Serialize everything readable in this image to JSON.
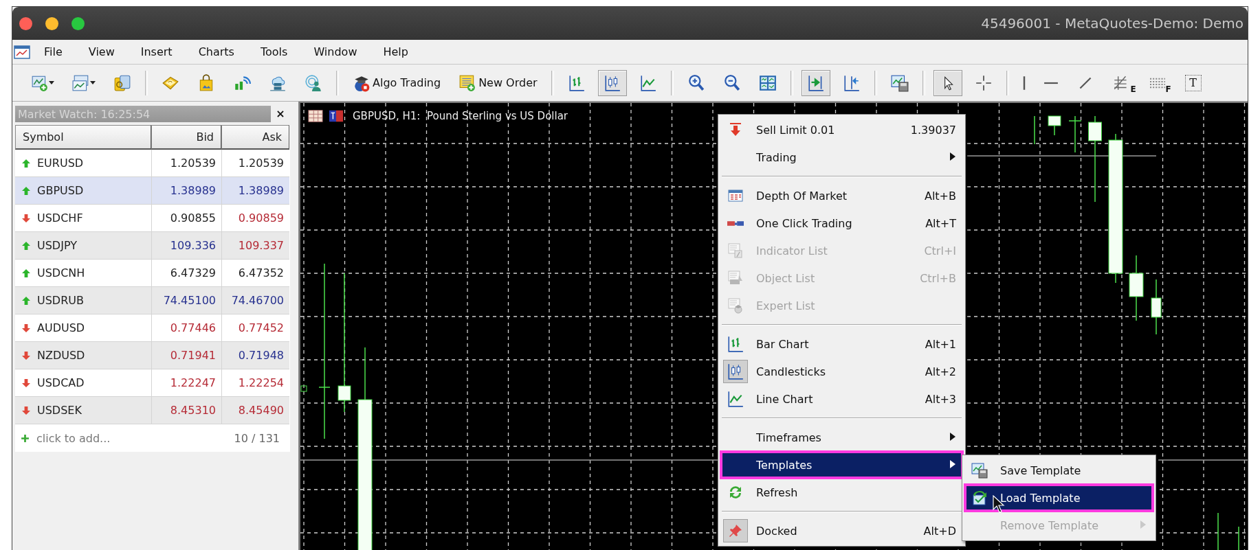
{
  "window": {
    "title": "45496001 - MetaQuotes-Demo: Demo"
  },
  "menu": [
    "File",
    "View",
    "Insert",
    "Charts",
    "Tools",
    "Window",
    "Help"
  ],
  "toolbar": [
    {
      "kind": "icon",
      "pressed": false,
      "dropdown": true
    },
    {
      "kind": "icon",
      "pressed": false,
      "dropdown": true
    },
    {
      "kind": "icon",
      "pressed": false,
      "dropdown": false
    },
    {
      "kind": "separator"
    },
    {
      "kind": "icon",
      "pressed": false,
      "dropdown": false
    },
    {
      "kind": "icon",
      "pressed": false,
      "dropdown": false
    },
    {
      "kind": "icon",
      "pressed": false,
      "dropdown": false
    },
    {
      "kind": "icon",
      "pressed": false,
      "dropdown": false
    },
    {
      "kind": "icon",
      "pressed": false,
      "dropdown": false
    },
    {
      "kind": "separator"
    },
    {
      "kind": "text",
      "label": "Algo Trading",
      "pressed": false
    },
    {
      "kind": "text",
      "label": "New Order",
      "pressed": false
    },
    {
      "kind": "separator"
    },
    {
      "kind": "icon",
      "pressed": false,
      "dropdown": false
    },
    {
      "kind": "icon",
      "pressed": true,
      "dropdown": false
    },
    {
      "kind": "icon",
      "pressed": false,
      "dropdown": false
    },
    {
      "kind": "separator"
    },
    {
      "kind": "icon",
      "pressed": false,
      "dropdown": false
    },
    {
      "kind": "icon",
      "pressed": false,
      "dropdown": false
    },
    {
      "kind": "icon",
      "pressed": false,
      "dropdown": false
    },
    {
      "kind": "separator"
    },
    {
      "kind": "icon",
      "pressed": true,
      "dropdown": false
    },
    {
      "kind": "icon",
      "pressed": false,
      "dropdown": false
    },
    {
      "kind": "separator"
    },
    {
      "kind": "icon",
      "pressed": false,
      "dropdown": false
    },
    {
      "kind": "separator"
    },
    {
      "kind": "icon",
      "pressed": true,
      "dropdown": false
    },
    {
      "kind": "icon",
      "pressed": false,
      "dropdown": false
    },
    {
      "kind": "separator"
    },
    {
      "kind": "icon",
      "pressed": false,
      "dropdown": false
    },
    {
      "kind": "icon",
      "pressed": false,
      "dropdown": false
    },
    {
      "kind": "icon",
      "pressed": false,
      "dropdown": false
    },
    {
      "kind": "badge-icon",
      "badge": "E",
      "pressed": false
    },
    {
      "kind": "badge-icon",
      "badge": "F",
      "pressed": false
    },
    {
      "kind": "letter",
      "label": "T",
      "pressed": false
    }
  ],
  "market_watch": {
    "title": "Market Watch: 16:25:54",
    "close": "×",
    "columns": [
      "Symbol",
      "Bid",
      "Ask"
    ],
    "rows": [
      {
        "symbol": "EURUSD",
        "bid": {
          "value": "1.20539",
          "color": "#222222"
        },
        "ask": {
          "value": "1.20539",
          "color": "#222222"
        },
        "rising": true,
        "selected": false
      },
      {
        "symbol": "GBPUSD",
        "bid": {
          "value": "1.38989",
          "color": "#27318f"
        },
        "ask": {
          "value": "1.38989",
          "color": "#27318f"
        },
        "rising": true,
        "selected": true
      },
      {
        "symbol": "USDCHF",
        "bid": {
          "value": "0.90855",
          "color": "#222222"
        },
        "ask": {
          "value": "0.90859",
          "color": "#b52a35"
        },
        "rising": false,
        "selected": false
      },
      {
        "symbol": "USDJPY",
        "bid": {
          "value": "109.336",
          "color": "#27318f"
        },
        "ask": {
          "value": "109.337",
          "color": "#b52a35"
        },
        "rising": true,
        "selected": false
      },
      {
        "symbol": "USDCNH",
        "bid": {
          "value": "6.47329",
          "color": "#222222"
        },
        "ask": {
          "value": "6.47352",
          "color": "#222222"
        },
        "rising": true,
        "selected": false
      },
      {
        "symbol": "USDRUB",
        "bid": {
          "value": "74.45100",
          "color": "#27318f"
        },
        "ask": {
          "value": "74.46700",
          "color": "#27318f"
        },
        "rising": true,
        "selected": false
      },
      {
        "symbol": "AUDUSD",
        "bid": {
          "value": "0.77446",
          "color": "#b52a35"
        },
        "ask": {
          "value": "0.77452",
          "color": "#b52a35"
        },
        "rising": false,
        "selected": false
      },
      {
        "symbol": "NZDUSD",
        "bid": {
          "value": "0.71941",
          "color": "#b52a35"
        },
        "ask": {
          "value": "0.71948",
          "color": "#27318f"
        },
        "rising": false,
        "selected": false
      },
      {
        "symbol": "USDCAD",
        "bid": {
          "value": "1.22247",
          "color": "#b52a35"
        },
        "ask": {
          "value": "1.22254",
          "color": "#b52a35"
        },
        "rising": false,
        "selected": false
      },
      {
        "symbol": "USDSEK",
        "bid": {
          "value": "8.45310",
          "color": "#b52a35"
        },
        "ask": {
          "value": "8.45490",
          "color": "#b52a35"
        },
        "rising": false,
        "selected": false
      }
    ],
    "add_label": "click to add...",
    "count": "10 / 131"
  },
  "chart": {
    "title": "GBPUSD, H1:  Pound Sterling vs US Dollar"
  },
  "context_menu": {
    "items": [
      {
        "kind": "item",
        "label": "Sell Limit 0.01",
        "shortcut": "1.39037",
        "disabled": false,
        "selected": false,
        "checked": false,
        "submenu": false,
        "outlined": false
      },
      {
        "kind": "item",
        "label": "Trading",
        "disabled": false,
        "selected": false,
        "checked": false,
        "submenu": true,
        "outlined": false
      },
      {
        "kind": "separator"
      },
      {
        "kind": "item",
        "label": "Depth Of Market",
        "shortcut": "Alt+B",
        "disabled": false,
        "selected": false,
        "checked": false,
        "submenu": false,
        "outlined": false
      },
      {
        "kind": "item",
        "label": "One Click Trading",
        "shortcut": "Alt+T",
        "disabled": false,
        "selected": false,
        "checked": false,
        "submenu": false,
        "outlined": false
      },
      {
        "kind": "item",
        "label": "Indicator List",
        "shortcut": "Ctrl+I",
        "disabled": true,
        "selected": false,
        "checked": false,
        "submenu": false,
        "outlined": false
      },
      {
        "kind": "item",
        "label": "Object List",
        "shortcut": "Ctrl+B",
        "disabled": true,
        "selected": false,
        "checked": false,
        "submenu": false,
        "outlined": false
      },
      {
        "kind": "item",
        "label": "Expert List",
        "disabled": true,
        "selected": false,
        "checked": false,
        "submenu": false,
        "outlined": false
      },
      {
        "kind": "separator"
      },
      {
        "kind": "item",
        "label": "Bar Chart",
        "shortcut": "Alt+1",
        "disabled": false,
        "selected": false,
        "checked": false,
        "submenu": false,
        "outlined": false
      },
      {
        "kind": "item",
        "label": "Candlesticks",
        "shortcut": "Alt+2",
        "disabled": false,
        "selected": false,
        "checked": true,
        "submenu": false,
        "outlined": false
      },
      {
        "kind": "item",
        "label": "Line Chart",
        "shortcut": "Alt+3",
        "disabled": false,
        "selected": false,
        "checked": false,
        "submenu": false,
        "outlined": false
      },
      {
        "kind": "separator"
      },
      {
        "kind": "item",
        "label": "Timeframes",
        "disabled": false,
        "selected": false,
        "checked": false,
        "submenu": true,
        "outlined": false
      },
      {
        "kind": "item",
        "label": "Templates",
        "disabled": false,
        "selected": true,
        "checked": false,
        "submenu": true,
        "outlined": true
      },
      {
        "kind": "item",
        "label": "Refresh",
        "disabled": false,
        "selected": false,
        "checked": false,
        "submenu": false,
        "outlined": false
      },
      {
        "kind": "separator"
      },
      {
        "kind": "item",
        "label": "Docked",
        "shortcut": "Alt+D",
        "disabled": false,
        "selected": false,
        "checked": true,
        "submenu": false,
        "outlined": false
      }
    ],
    "submenu": [
      {
        "kind": "item",
        "label": "Save Template",
        "disabled": false,
        "selected": false,
        "submenu": false,
        "outlined": false
      },
      {
        "kind": "item",
        "label": "Load Template",
        "disabled": false,
        "selected": true,
        "submenu": false,
        "outlined": true
      },
      {
        "kind": "item",
        "label": "Remove Template",
        "disabled": true,
        "selected": false,
        "submenu": true,
        "outlined": false
      }
    ]
  }
}
